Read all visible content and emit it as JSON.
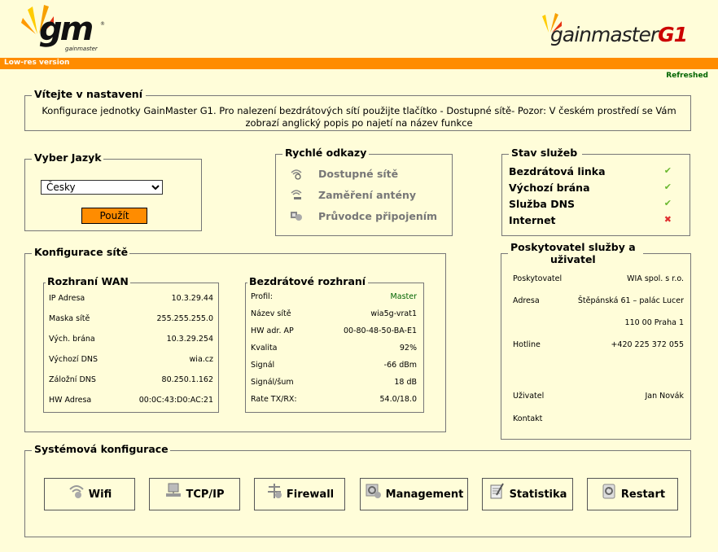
{
  "header": {
    "logo_small_text": "gm",
    "logo_small_sub": "gainmaster",
    "logo_big_text": "gainmaster",
    "logo_big_suffix": "G1",
    "lowres_label": "Low-res version",
    "refreshed_label": "Refreshed"
  },
  "welcome": {
    "title": "Vítejte v nastavení",
    "text": "Konfigurace jednotky GainMaster G1. Pro nalezení bezdrátových sítí použijte tlačítko - Dostupné sítě- Pozor: V českém prostředí se Vám zobrazí anglický popis po najetí na název funkce"
  },
  "language": {
    "title": "Vyber Jazyk",
    "selected": "Česky",
    "apply_label": "Použít"
  },
  "quick_links": {
    "title": "Rychlé odkazy",
    "items": [
      {
        "label": "Dostupné sítě",
        "icon": "wifi-search-icon"
      },
      {
        "label": "Zaměření antény",
        "icon": "antenna-align-icon"
      },
      {
        "label": "Průvodce připojením",
        "icon": "wizard-icon"
      }
    ]
  },
  "services": {
    "title": "Stav služeb",
    "items": [
      {
        "label": "Bezdrátová linka",
        "status": "✔",
        "state": "ok"
      },
      {
        "label": "Výchozí brána",
        "status": "✔",
        "state": "ok"
      },
      {
        "label": "Služba DNS",
        "status": "✔",
        "state": "ok"
      },
      {
        "label": "Internet",
        "status": "✖",
        "state": "bad"
      }
    ]
  },
  "network": {
    "title": "Konfigurace sítě",
    "wan": {
      "title": "Rozhraní WAN",
      "rows": [
        {
          "k": "IP Adresa",
          "v": "10.3.29.44"
        },
        {
          "k": "Maska sítě",
          "v": "255.255.255.0"
        },
        {
          "k": "Vých. brána",
          "v": "10.3.29.254"
        },
        {
          "k": "Výchozí DNS",
          "v": "wia.cz"
        },
        {
          "k": "Záložní DNS",
          "v": "80.250.1.162"
        },
        {
          "k": "HW Adresa",
          "v": "00:0C:43:D0:AC:21"
        }
      ]
    },
    "wireless": {
      "title": "Bezdrátové rozhraní",
      "rows": [
        {
          "k": "Profil:",
          "v": "Master"
        },
        {
          "k": "Název sítě",
          "v": "wia5g-vrat1"
        },
        {
          "k": "HW adr. AP",
          "v": "00-80-48-50-BA-E1"
        },
        {
          "k": "Kvalita",
          "v": "92%"
        },
        {
          "k": "Signál",
          "v": "-66 dBm"
        },
        {
          "k": "Signál/šum",
          "v": "18 dB"
        },
        {
          "k": "Rate TX/RX:",
          "v": "54.0/18.0"
        }
      ]
    }
  },
  "provider": {
    "title_line1": "Poskytovatel služby a",
    "title_line2": "uživatel",
    "rows": {
      "provider_k": "Poskytovatel",
      "provider_v": "WIA spol. s r.o.",
      "address_k": "Adresa",
      "address_v1": "Štěpánská 61 – palác Lucer",
      "address_v2": "110 00 Praha 1",
      "hotline_k": "Hotline",
      "hotline_v": "+420 225 372 055",
      "user_k": "Uživatel",
      "user_v": "Jan Novák",
      "contact_k": "Kontakt",
      "contact_v": ""
    }
  },
  "system": {
    "title": "Systémová konfigurace",
    "buttons": [
      {
        "label": "Wifi",
        "icon": "wifi-icon"
      },
      {
        "label": "TCP/IP",
        "icon": "network-icon"
      },
      {
        "label": "Firewall",
        "icon": "firewall-icon"
      },
      {
        "label": "Management",
        "icon": "management-icon"
      },
      {
        "label": "Statistika",
        "icon": "statistics-icon"
      },
      {
        "label": "Restart",
        "icon": "restart-icon"
      }
    ]
  },
  "colors": {
    "background": "#fffdd9",
    "orange": "#ff8c00",
    "ok": "#6ab82f",
    "bad": "#e03030",
    "refreshed": "#006400"
  }
}
